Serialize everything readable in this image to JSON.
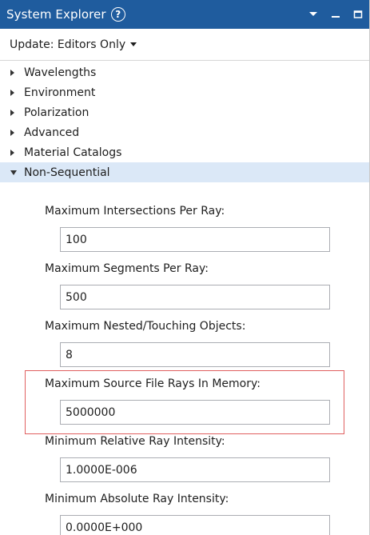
{
  "window": {
    "title": "System Explorer",
    "help_glyph": "?",
    "colors": {
      "titlebar": "#1f5c9e",
      "selected_row": "#dbe8f7",
      "highlight_border": "#e06060"
    }
  },
  "update": {
    "label": "Update: Editors Only"
  },
  "tree": {
    "items": [
      {
        "label": "Wavelengths",
        "expanded": false
      },
      {
        "label": "Environment",
        "expanded": false
      },
      {
        "label": "Polarization",
        "expanded": false
      },
      {
        "label": "Advanced",
        "expanded": false
      },
      {
        "label": "Material Catalogs",
        "expanded": false
      },
      {
        "label": "Non-Sequential",
        "expanded": true
      }
    ]
  },
  "fields": [
    {
      "label": "Maximum Intersections Per Ray:",
      "value": "100"
    },
    {
      "label": "Maximum Segments Per Ray:",
      "value": "500"
    },
    {
      "label": "Maximum Nested/Touching Objects:",
      "value": "8"
    },
    {
      "label": "Maximum Source File Rays In Memory:",
      "value": "5000000"
    },
    {
      "label": "Minimum Relative Ray Intensity:",
      "value": "1.0000E-006"
    },
    {
      "label": "Minimum Absolute Ray Intensity:",
      "value": "0.0000E+000"
    }
  ]
}
